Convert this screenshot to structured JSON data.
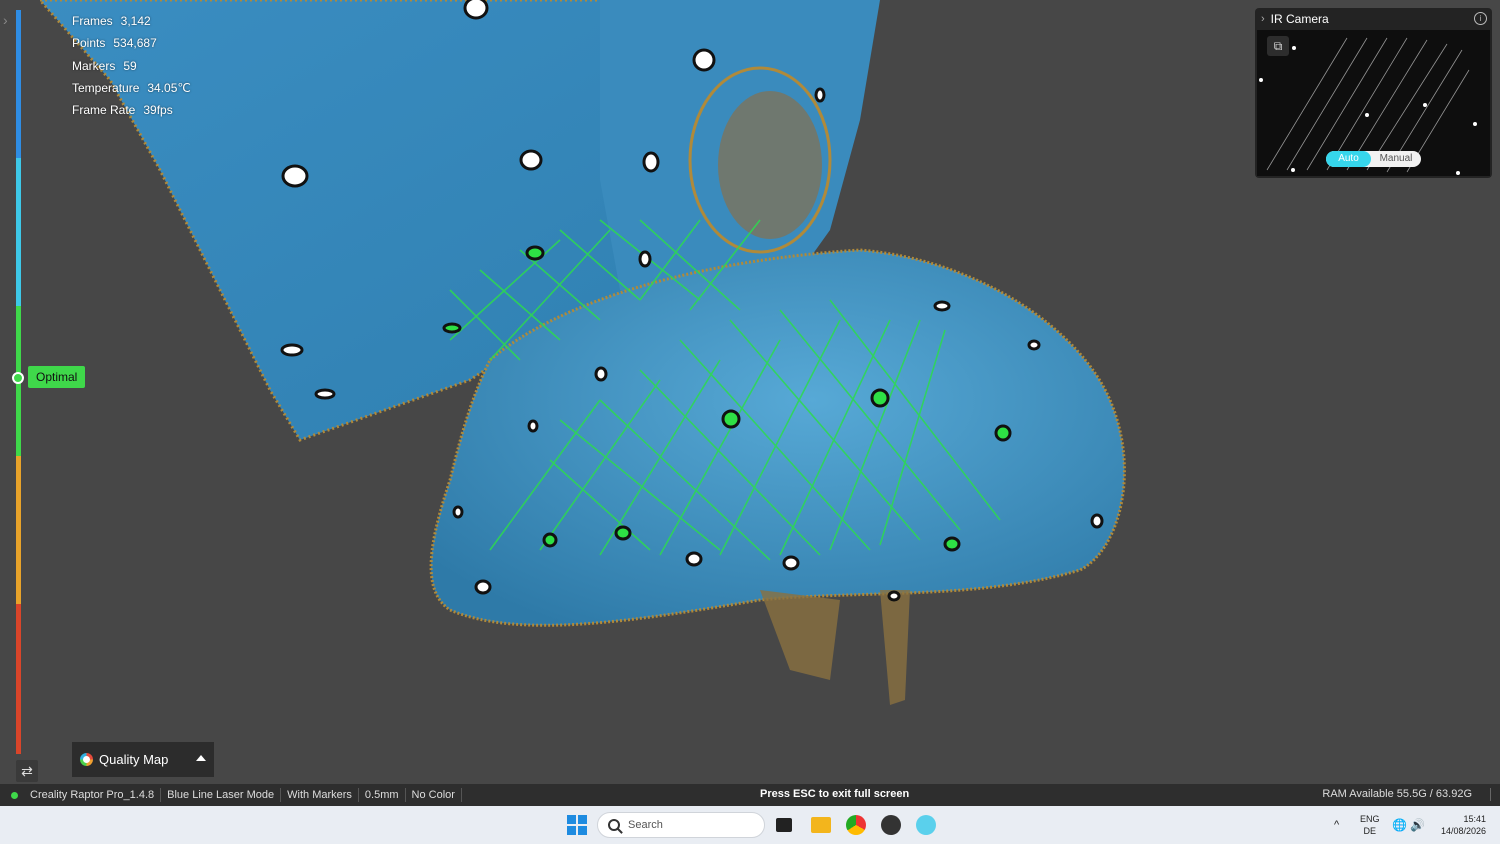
{
  "stats": [
    {
      "label": "Frames",
      "value": "3,142"
    },
    {
      "label": "Points",
      "value": "534,687"
    },
    {
      "label": "Markers",
      "value": "59"
    },
    {
      "label": "Temperature",
      "value": "34.05℃"
    },
    {
      "label": "Frame Rate",
      "value": "39fps"
    }
  ],
  "quality": {
    "badge_label": "Optimal",
    "colors": [
      "#2f8de4",
      "#3ec8e8",
      "#3fd84a",
      "#e8a32a",
      "#d9452a"
    ]
  },
  "quality_map": {
    "label": "Quality Map"
  },
  "ir_camera": {
    "title": "IR Camera",
    "toggle_auto": "Auto",
    "toggle_manual": "Manual"
  },
  "statusbar": {
    "app": "Creality Raptor Pro_1.4.8",
    "mode": "Blue Line Laser Mode",
    "markers": "With Markers",
    "resolution": "0.5mm",
    "color": "No Color",
    "esc_hint": "Press ESC to exit full screen",
    "ram": "RAM Available 55.5G / 63.92G"
  },
  "taskbar": {
    "search_placeholder": "Search",
    "lang_top": "ENG",
    "lang_bottom": "DE",
    "time": "15:41",
    "date": "14/08/2026"
  },
  "scene_colors": {
    "scan_surface": "#3c8fc0",
    "laser_lines": "#2ddb4e",
    "edge_noise": "#b08a3a"
  }
}
